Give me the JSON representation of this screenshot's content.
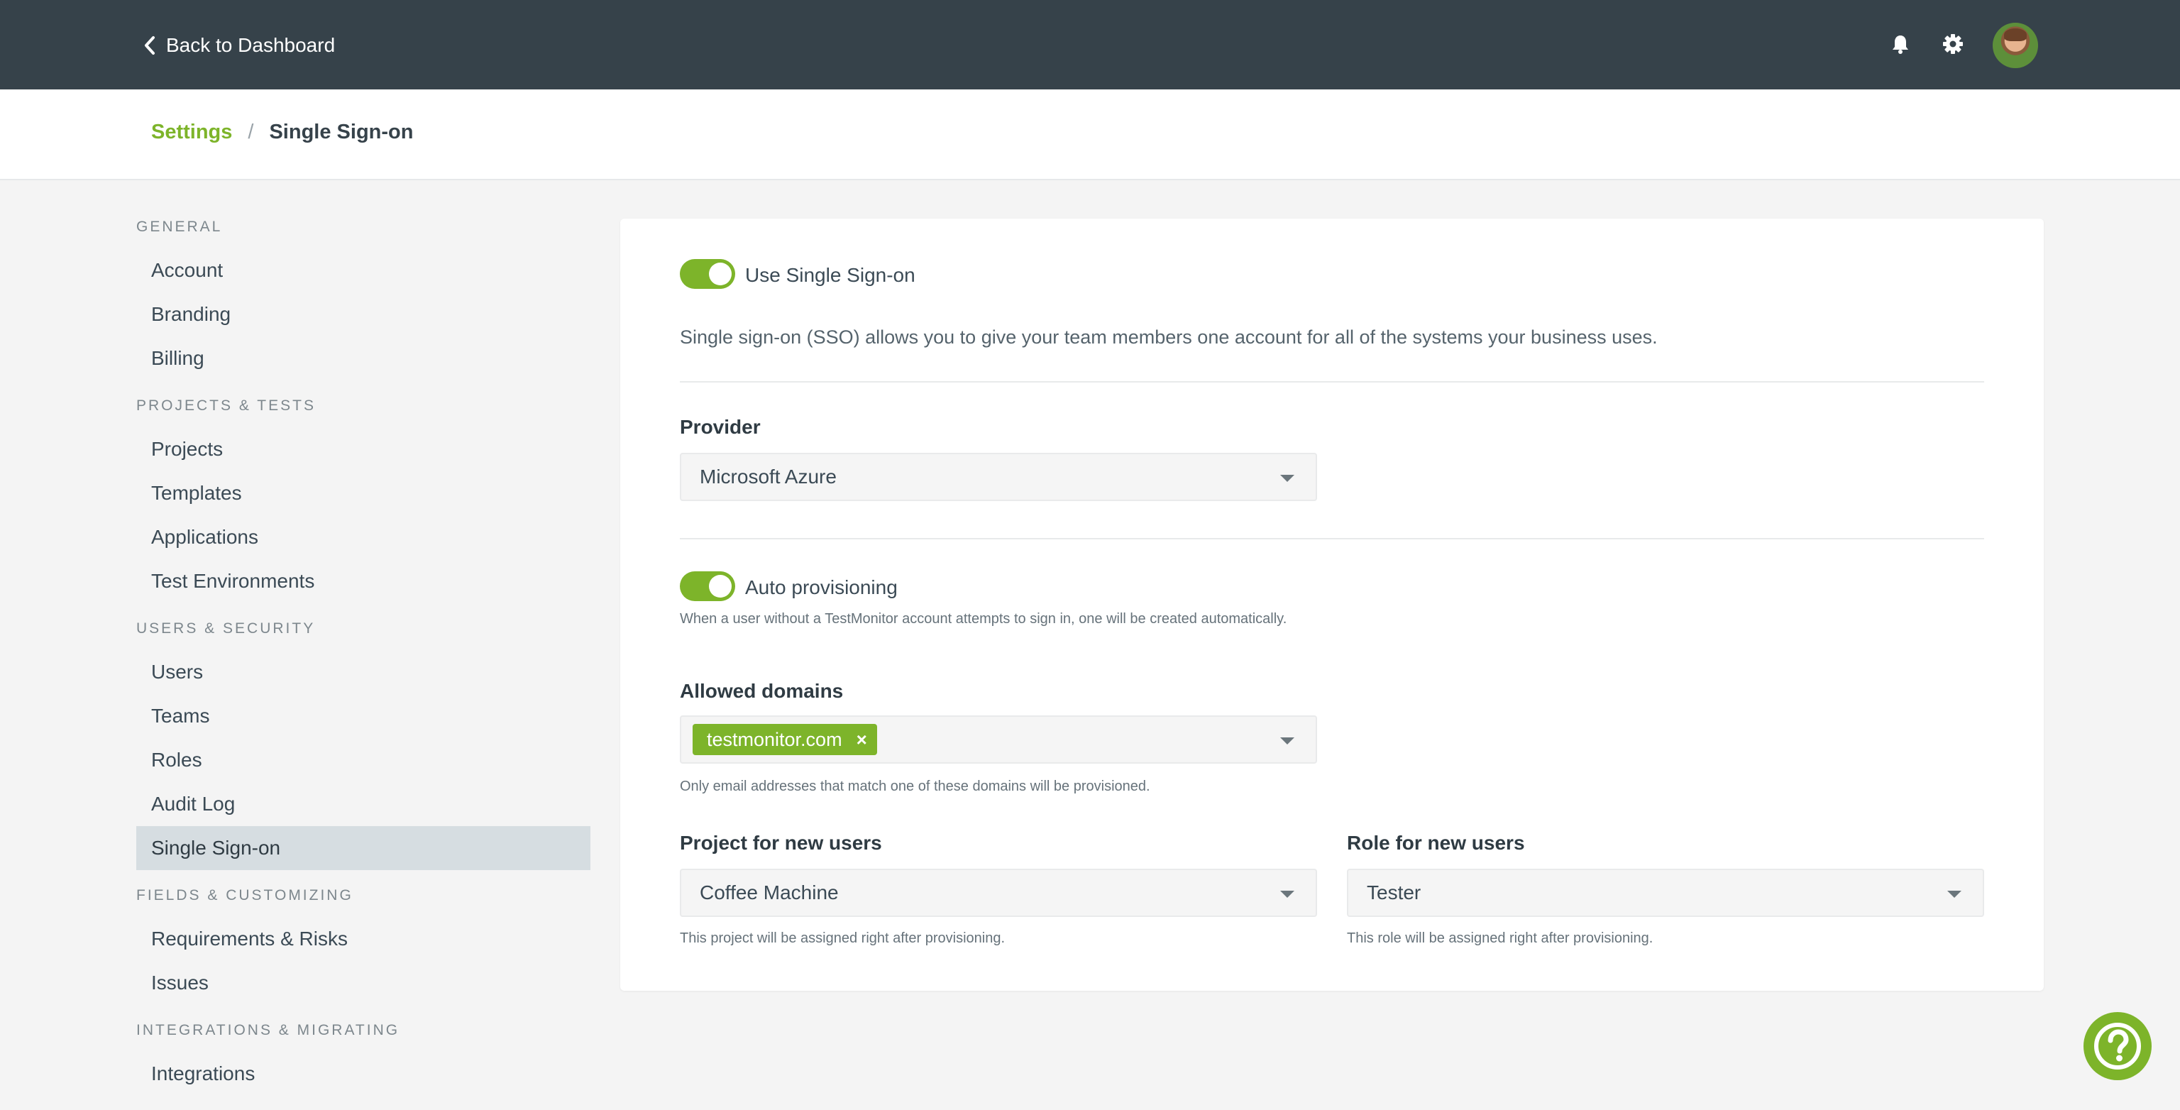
{
  "topbar": {
    "back_label": "Back to Dashboard",
    "icons": [
      "bell-icon",
      "gear-icon",
      "avatar"
    ]
  },
  "breadcrumb": {
    "root": "Settings",
    "separator": "/",
    "current": "Single Sign-on"
  },
  "sidebar": {
    "sections": [
      {
        "title": "GENERAL",
        "items": [
          "Account",
          "Branding",
          "Billing"
        ]
      },
      {
        "title": "PROJECTS & TESTS",
        "items": [
          "Projects",
          "Templates",
          "Applications",
          "Test Environments"
        ]
      },
      {
        "title": "USERS & SECURITY",
        "items": [
          "Users",
          "Teams",
          "Roles",
          "Audit Log",
          "Single Sign-on"
        ]
      },
      {
        "title": "FIELDS & CUSTOMIZING",
        "items": [
          "Requirements & Risks",
          "Issues"
        ]
      },
      {
        "title": "INTEGRATIONS & MIGRATING",
        "items": [
          "Integrations"
        ]
      }
    ],
    "active_item": "Single Sign-on"
  },
  "sso": {
    "toggle_label": "Use Single Sign-on",
    "toggle_on": true,
    "description": "Single sign-on (SSO) allows you to give your team members one account for all of the systems your business uses.",
    "provider_label": "Provider",
    "provider_value": "Microsoft Azure",
    "auto_label": "Auto provisioning",
    "auto_on": true,
    "auto_help": "When a user without a TestMonitor account attempts to sign in, one will be created automatically.",
    "domains_label": "Allowed domains",
    "domain_tag": "testmonitor.com",
    "domain_tag_remove": "×",
    "domains_help": "Only email addresses that match one of these domains will be provisioned.",
    "project_label": "Project for new users",
    "project_value": "Coffee Machine",
    "project_help": "This project will be assigned right after provisioning.",
    "role_label": "Role for new users",
    "role_value": "Tester",
    "role_help": "This role will be assigned right after provisioning."
  },
  "colors": {
    "accent": "#7db42a",
    "topbar": "#36424a",
    "active_nav": "#d6dde1"
  }
}
